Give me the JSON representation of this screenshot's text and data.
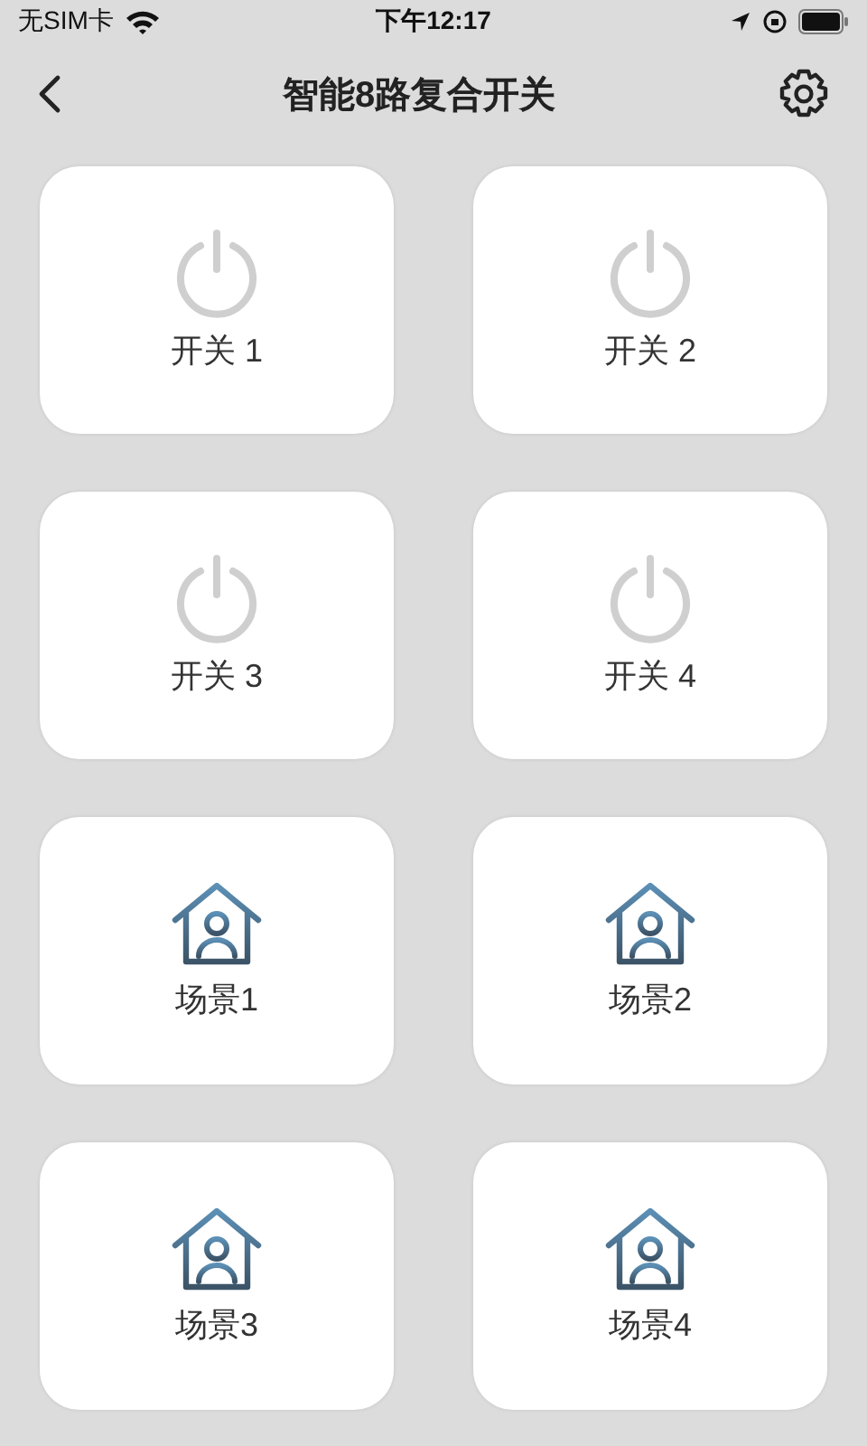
{
  "status_bar": {
    "carrier": "无SIM卡",
    "time": "下午12:17"
  },
  "nav": {
    "title": "智能8路复合开关"
  },
  "tiles": [
    {
      "kind": "switch",
      "label": "开关 1",
      "on": false
    },
    {
      "kind": "switch",
      "label": "开关 2",
      "on": false
    },
    {
      "kind": "switch",
      "label": "开关 3",
      "on": false
    },
    {
      "kind": "switch",
      "label": "开关 4",
      "on": false
    },
    {
      "kind": "scene",
      "label": "场景1"
    },
    {
      "kind": "scene",
      "label": "场景2"
    },
    {
      "kind": "scene",
      "label": "场景3"
    },
    {
      "kind": "scene",
      "label": "场景4"
    }
  ]
}
